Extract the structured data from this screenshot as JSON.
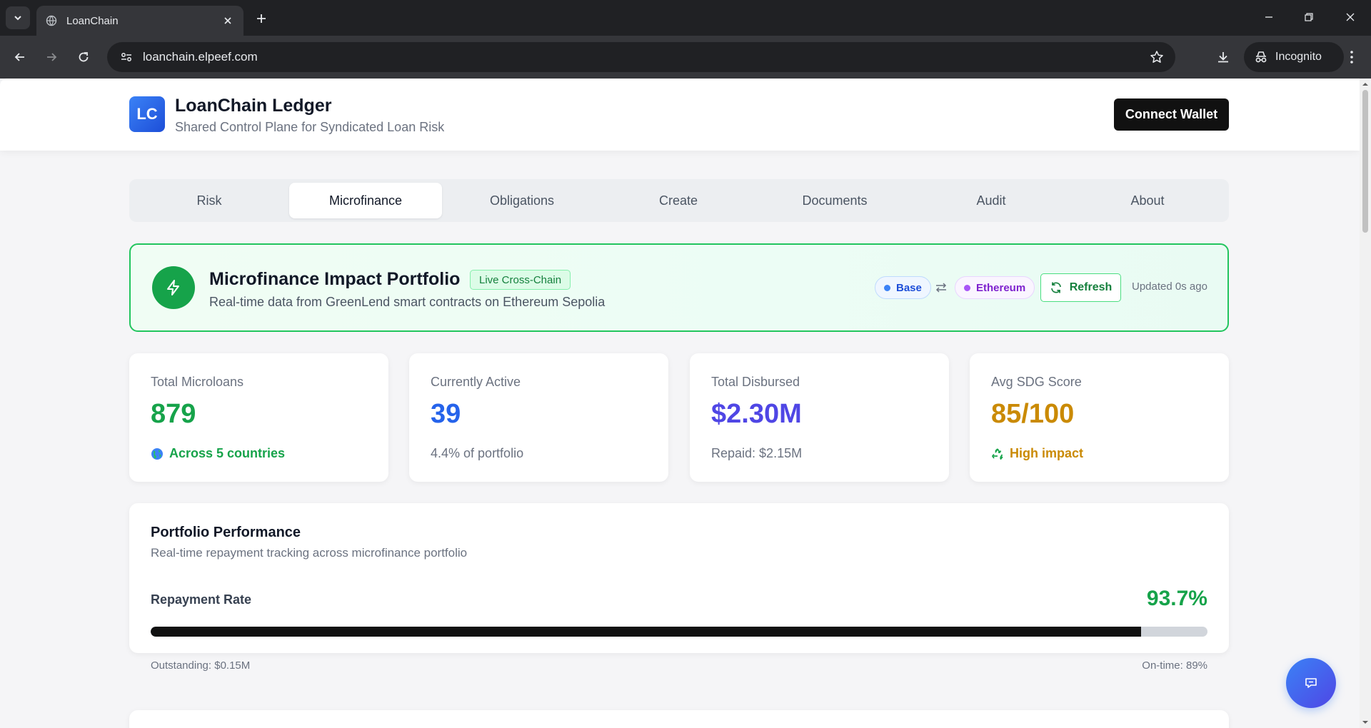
{
  "browser": {
    "tab_title": "LoanChain",
    "url": "loanchain.elpeef.com",
    "incognito_label": "Incognito"
  },
  "header": {
    "logo_text": "LC",
    "title": "LoanChain Ledger",
    "subtitle": "Shared Control Plane for Syndicated Loan Risk",
    "connect_label": "Connect Wallet"
  },
  "nav": {
    "tabs": [
      {
        "label": "Risk"
      },
      {
        "label": "Microfinance"
      },
      {
        "label": "Obligations"
      },
      {
        "label": "Create"
      },
      {
        "label": "Documents"
      },
      {
        "label": "Audit"
      },
      {
        "label": "About"
      }
    ],
    "active": "Microfinance"
  },
  "banner": {
    "title": "Microfinance Impact Portfolio",
    "badge": "Live Cross-Chain",
    "subtitle": "Real-time data from GreenLend smart contracts on Ethereum Sepolia",
    "chain_a": "Base",
    "chain_b": "Ethereum",
    "refresh_label": "Refresh",
    "updated": "Updated 0s ago"
  },
  "stats": [
    {
      "label": "Total Microloans",
      "value": "879",
      "foot": "Across 5 countries",
      "foot_icon": "globe-icon"
    },
    {
      "label": "Currently Active",
      "value": "39",
      "foot": "4.4% of portfolio"
    },
    {
      "label": "Total Disbursed",
      "value": "$2.30M",
      "foot": "Repaid: $2.15M"
    },
    {
      "label": "Avg SDG Score",
      "value": "85/100",
      "foot": "High impact",
      "foot_icon": "recycle-icon"
    }
  ],
  "performance": {
    "title": "Portfolio Performance",
    "subtitle": "Real-time repayment tracking across microfinance portfolio",
    "rate_label": "Repayment Rate",
    "rate_value": "93.7%",
    "rate_fraction": 0.937,
    "outstanding": "Outstanding: $0.15M",
    "ontime": "On-time: 89%"
  },
  "colors": {
    "green": "#16a34a",
    "blue": "#2563eb",
    "purple": "#4f46e5",
    "amber": "#ca8a04",
    "dark": "#111111"
  }
}
